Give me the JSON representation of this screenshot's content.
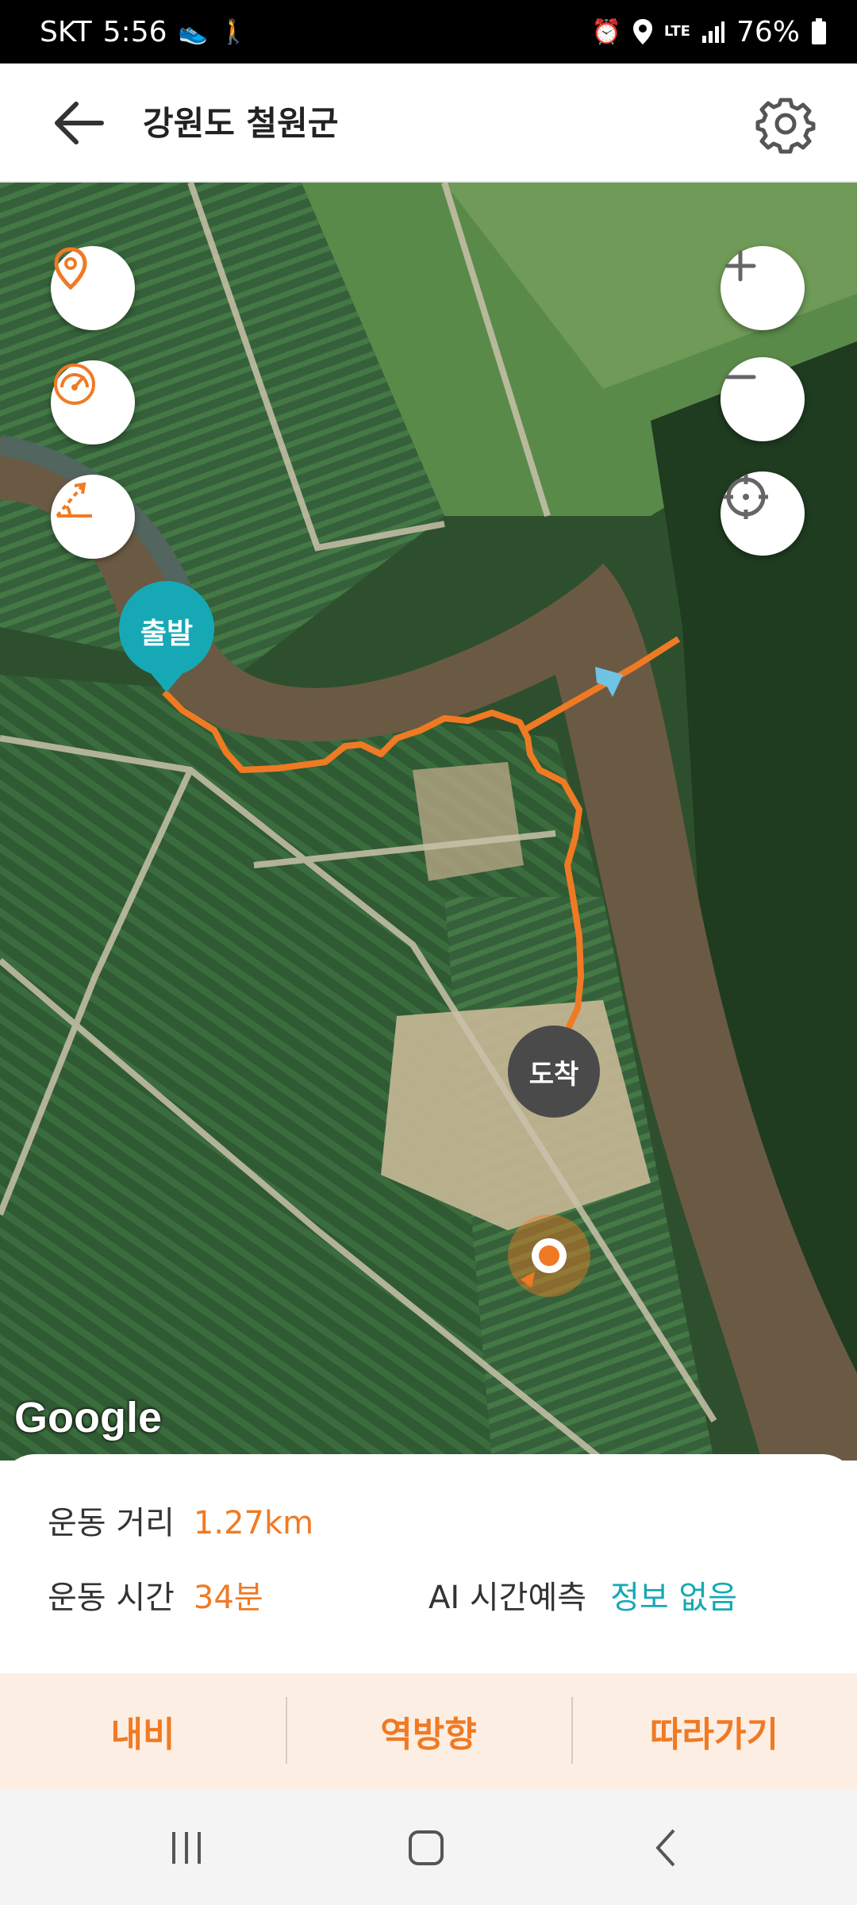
{
  "status_bar": {
    "carrier": "SKT",
    "time": "5:56",
    "network": "LTE",
    "battery": "76%"
  },
  "header": {
    "title": "강원도 철원군",
    "back_icon": "arrow-left-icon",
    "settings_icon": "gear-icon"
  },
  "map": {
    "start_label": "출발",
    "end_label": "도착",
    "attribution": "Google",
    "route_color": "#f07a24",
    "start_color": "#16a9b5",
    "end_color": "#4a4a4a"
  },
  "info": {
    "distance_label": "운동 거리",
    "distance_value": "1.27km",
    "time_label": "운동 시간",
    "time_value": "34분",
    "ai_label": "AI 시간예측",
    "ai_value": "정보 없음"
  },
  "actions": {
    "navi": "내비",
    "reverse": "역방향",
    "follow": "따라가기"
  },
  "colors": {
    "accent": "#f07a24",
    "teal": "#16a9b5",
    "action_bg": "#fdeee3"
  }
}
